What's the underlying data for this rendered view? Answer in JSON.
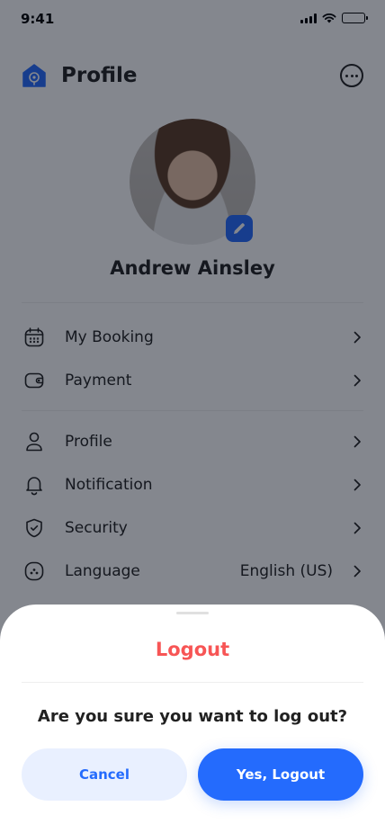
{
  "status_bar": {
    "time": "9:41"
  },
  "header": {
    "title": "Profile"
  },
  "user": {
    "name": "Andrew Ainsley"
  },
  "menu": {
    "items": [
      {
        "label": "My Booking",
        "icon": "calendar-icon"
      },
      {
        "label": "Payment",
        "icon": "wallet-icon"
      },
      {
        "label": "Profile",
        "icon": "user-icon"
      },
      {
        "label": "Notification",
        "icon": "bell-icon"
      },
      {
        "label": "Security",
        "icon": "shield-icon"
      },
      {
        "label": "Language",
        "icon": "language-icon",
        "value": "English (US)"
      }
    ]
  },
  "logout_sheet": {
    "title": "Logout",
    "message": "Are you sure you want to log out?",
    "cancel_label": "Cancel",
    "confirm_label": "Yes, Logout"
  },
  "colors": {
    "primary": "#246bfd",
    "danger": "#f75555",
    "text": "#212121",
    "overlay": "rgba(9,16,29,0.5)"
  }
}
